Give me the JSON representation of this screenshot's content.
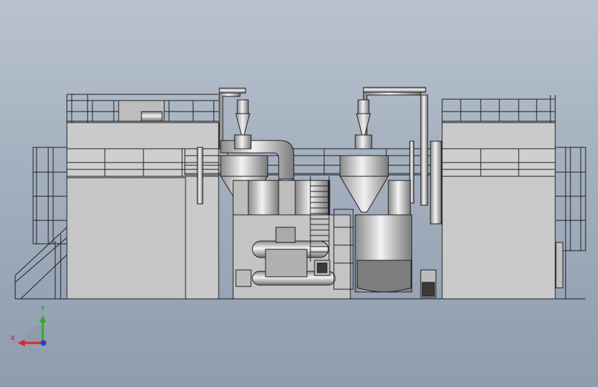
{
  "triad": {
    "x_label": "X",
    "y_label": "Y",
    "x_color": "#d42a2a",
    "y_color": "#27b027",
    "z_color": "#2a3ad4"
  },
  "colors": {
    "background": "#a3afbe",
    "metal": "#c9c9c9",
    "outline": "#1a1a1a"
  },
  "icons": [
    "coordinate-triad-icon"
  ]
}
